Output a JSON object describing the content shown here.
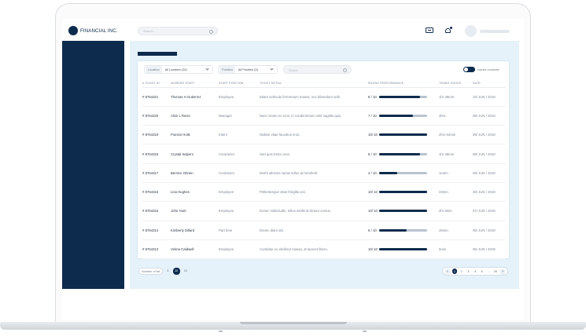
{
  "brand": {
    "name": "FINANCIAL INC."
  },
  "header": {
    "search_placeholder": "Search..."
  },
  "filters": {
    "location": {
      "tag": "Location",
      "value": "All Location (32)"
    },
    "position": {
      "tag": "Position",
      "value": "All Position (5)"
    },
    "search_placeholder": "Search",
    "toggle_label": "Include contractor"
  },
  "table": {
    "columns": [
      "# TICKET ID",
      "WORKER STAFF",
      "STAFF POSITION",
      "TICKET DETAIL",
      "RATING PERFORMANCE",
      "TIMING HOURS",
      "DATE"
    ],
    "rows": [
      {
        "id": "# 8764321",
        "name": "Thomas H Gutierrez",
        "position": "Employee",
        "detail": "Etiam vehicula fermentum massa, nec bibendum velit.",
        "rating": "8 / 10",
        "score": 0.86,
        "hours": "1hr 38min",
        "date": "10/ JUN / 2019"
      },
      {
        "id": "# 8764320",
        "name": "Alvin L Reiss",
        "position": "Manager",
        "detail": "Nam ornare ex eros, in condimentum velit sagittis quis.",
        "rating": "7 / 10",
        "score": 0.7,
        "hours": "3hrs",
        "date": "09/ JUN / 2019"
      },
      {
        "id": "# 8764319",
        "name": "Francis Holtz",
        "position": "Intern",
        "detail": "Nullam vitae faucibus eros.",
        "rating": "10/ 10",
        "score": 1.0,
        "hours": "2hrs 52min",
        "date": "09/ JUN / 2019"
      },
      {
        "id": "# 8764318",
        "name": "Crystal Salyers",
        "position": "Contractor",
        "detail": "Sed quis tortor urna.",
        "rating": "8 / 10",
        "score": 0.86,
        "hours": "1hr 38min",
        "date": "08/ JUN / 2019"
      },
      {
        "id": "# 8764317",
        "name": "Bernice Obrien",
        "position": "Contractor",
        "detail": "Morbi ultricies varius tellus at hendrerit.",
        "rating": "4 / 10",
        "score": 0.38,
        "hours": "1emin",
        "date": "08/ JUN / 2019"
      },
      {
        "id": "# 8764316",
        "name": "Lisa Hughes",
        "position": "Employee",
        "detail": "Pellentesque vitae fringilla orci.",
        "rating": "10/ 10",
        "score": 1.0,
        "hours": "23min",
        "date": "08/ JUN / 2019"
      },
      {
        "id": "# 8764315",
        "name": "John Hunt",
        "position": "Employee",
        "detail": "Donec sollicitudin, tellus eleifend dictum cursus.",
        "rating": "10/ 10",
        "score": 1.0,
        "hours": "2hr 8min",
        "date": "07/ JUN / 2019"
      },
      {
        "id": "# 8764314",
        "name": "Kimberly Dillard",
        "position": "Part time",
        "detail": "Donec diam dui.",
        "rating": "6 / 10",
        "score": 0.58,
        "hours": "46min",
        "date": "06/ JUN / 2019"
      },
      {
        "id": "# 8764313",
        "name": "Velma Caldwell",
        "position": "Employee",
        "detail": "Curabitur eu eleifend massa, at laoreet libero.",
        "rating": "10/ 10",
        "score": 1.0,
        "hours": "5min",
        "date": "06/ JUN / 2019"
      }
    ]
  },
  "footer": {
    "rows_label": "Number of list",
    "rows_options": [
      "8",
      "10",
      "20"
    ],
    "rows_selected": "10",
    "pages": [
      "1",
      "2",
      "3",
      "4",
      "5",
      "...",
      "20"
    ],
    "current_page": "1",
    "prev": "‹",
    "next": "›"
  },
  "colors": {
    "primary": "#0d2b4d",
    "background": "#e6f2fa"
  }
}
